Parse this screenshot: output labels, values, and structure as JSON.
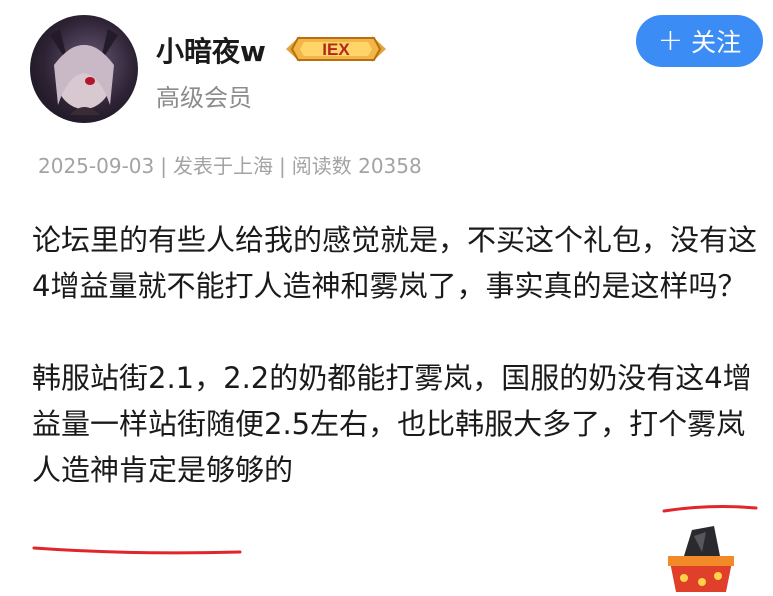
{
  "user": {
    "name": "小暗夜w",
    "member_level": "高级会员",
    "badge_text": "IEX"
  },
  "follow_button": {
    "icon": "plus-icon",
    "label": "关注"
  },
  "meta": {
    "date": "2025-09-03",
    "location": "发表于上海",
    "views": "阅读数 20358",
    "separator": "|"
  },
  "post": {
    "paragraph1": "论坛里的有些人给我的感觉就是，不买这个礼包，没有这4增益量就不能打人造神和雾岚了，事实真的是这样吗？",
    "paragraph2": "韩服站街2.1，2.2的奶都能打雾岚，国服的奶没有这4增益量一样站街随便2.5左右，也比韩服大多了，打个雾岚人造神肯定是够够的"
  },
  "colors": {
    "accent": "#3b8cf5",
    "annotation": "#e0262b",
    "meta": "#a3a3a3",
    "member": "#8c8c8c"
  }
}
